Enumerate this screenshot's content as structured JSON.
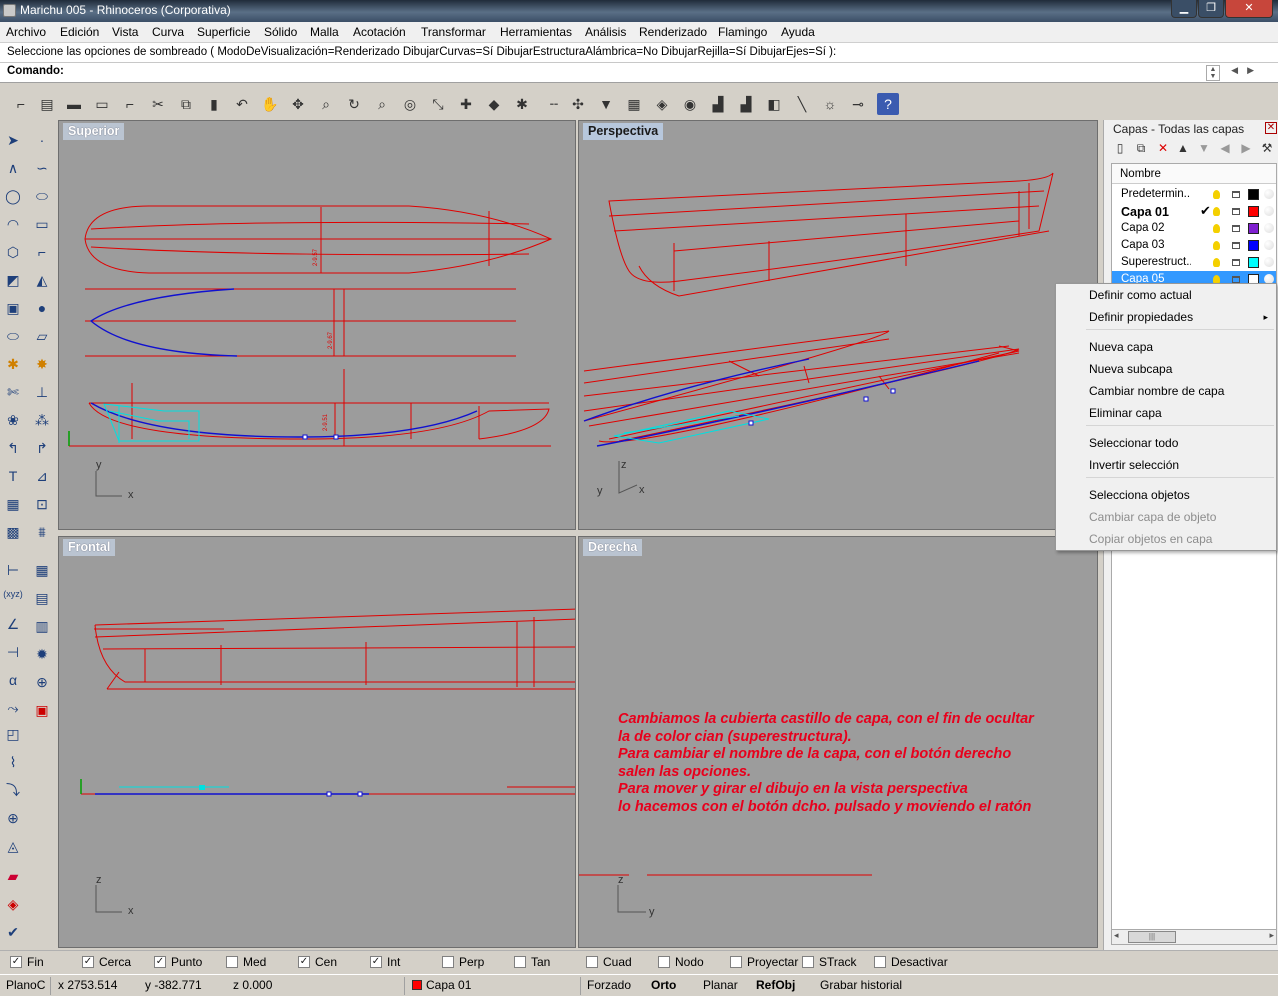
{
  "window": {
    "title": "Marichu 005 - Rhinoceros (Corporativa)",
    "minimize": "▁",
    "maximize": "❐",
    "close": "✕"
  },
  "menu": [
    "Archivo",
    "Edición",
    "Vista",
    "Curva",
    "Superficie",
    "Sólido",
    "Malla",
    "Acotación",
    "Transformar",
    "Herramientas",
    "Análisis",
    "Renderizado",
    "Flamingo",
    "Ayuda"
  ],
  "command": {
    "history": "Seleccione las opciones de sombreado ( ModoDeVisualización=Renderizado  DibujarCurvas=Sí  DibujarEstructuraAlámbrica=No  DibujarRejilla=Sí  DibujarEjes=Sí ):",
    "prompt": "Comando:"
  },
  "viewports": {
    "top": {
      "title": "Superior",
      "axis_x": "x",
      "axis_y": "y"
    },
    "perspective": {
      "title": "Perspectiva",
      "axis_x": "x",
      "axis_y": "y",
      "axis_z": "z"
    },
    "front": {
      "title": "Frontal",
      "axis_x": "x",
      "axis_z": "z"
    },
    "right": {
      "title": "Derecha",
      "axis_y": "y",
      "axis_z": "z"
    },
    "dim_labels": [
      "2-9.57",
      "2-9.67",
      "2-9.51"
    ]
  },
  "annotation": {
    "lines": [
      "Cambiamos la cubierta castillo de capa, con el fin de ocultar",
      "la de color cian (superestructura).",
      "Para cambiar el nombre de la capa, con el botón derecho",
      "salen las opciones.",
      "Para mover y girar el dibujo en la vista perspectiva",
      "lo hacemos con el botón dcho. pulsado y moviendo el ratón"
    ],
    "color": "#e8001c"
  },
  "layers_panel": {
    "title": "Capas - Todas las capas",
    "column_name": "Nombre",
    "rows": [
      {
        "name": "Predetermin...",
        "color": "#000000",
        "current": false,
        "selected": false
      },
      {
        "name": "Capa 01",
        "color": "#ff0000",
        "current": true,
        "selected": false,
        "check": "✔"
      },
      {
        "name": "Capa 02",
        "color": "#7f1fd0",
        "current": false,
        "selected": false
      },
      {
        "name": "Capa 03",
        "color": "#0000ff",
        "current": false,
        "selected": false
      },
      {
        "name": "Superestruct...",
        "color": "#00ffff",
        "current": false,
        "selected": false
      },
      {
        "name": "Capa 05",
        "color": "#ffffff",
        "current": false,
        "selected": true
      }
    ]
  },
  "context_menu": {
    "items": [
      {
        "label": "Definir como actual",
        "enabled": true
      },
      {
        "label": "Definir propiedades",
        "enabled": true,
        "submenu": true
      },
      {
        "label": "Nueva capa",
        "enabled": true
      },
      {
        "label": "Nueva subcapa",
        "enabled": true
      },
      {
        "label": "Cambiar nombre de capa",
        "enabled": true
      },
      {
        "label": "Eliminar capa",
        "enabled": true
      },
      {
        "label": "Seleccionar todo",
        "enabled": true
      },
      {
        "label": "Invertir selección",
        "enabled": true
      },
      {
        "label": "Selecciona objetos",
        "enabled": true
      },
      {
        "label": "Cambiar capa de objeto",
        "enabled": false
      },
      {
        "label": "Copiar objetos en capa",
        "enabled": false
      }
    ],
    "submenu_arrow": "▸"
  },
  "osnaps": [
    {
      "label": "Fin",
      "checked": true
    },
    {
      "label": "Cerca",
      "checked": true
    },
    {
      "label": "Punto",
      "checked": true
    },
    {
      "label": "Med",
      "checked": false
    },
    {
      "label": "Cen",
      "checked": true
    },
    {
      "label": "Int",
      "checked": true
    },
    {
      "label": "Perp",
      "checked": false
    },
    {
      "label": "Tan",
      "checked": false
    },
    {
      "label": "Cuad",
      "checked": false
    },
    {
      "label": "Nodo",
      "checked": false
    },
    {
      "label": "Proyectar",
      "checked": false
    },
    {
      "label": "STrack",
      "checked": false
    },
    {
      "label": "Desactivar",
      "checked": false
    }
  ],
  "status": {
    "cplane": "PlanoC",
    "x": "x 2753.514",
    "y": "y -382.771",
    "z": "z 0.000",
    "layer": "Capa 01",
    "layer_color": "#ff0000",
    "forzado": "Forzado",
    "orto": "Orto",
    "planar": "Planar",
    "refobj": "RefObj",
    "historial": "Grabar historial"
  },
  "colors": {
    "viewport_bg": "#9c9c9c",
    "curve_red": "#e00000",
    "curve_blue": "#1010d0",
    "curve_cyan": "#00e0e0",
    "axis_green": "#00a000"
  }
}
